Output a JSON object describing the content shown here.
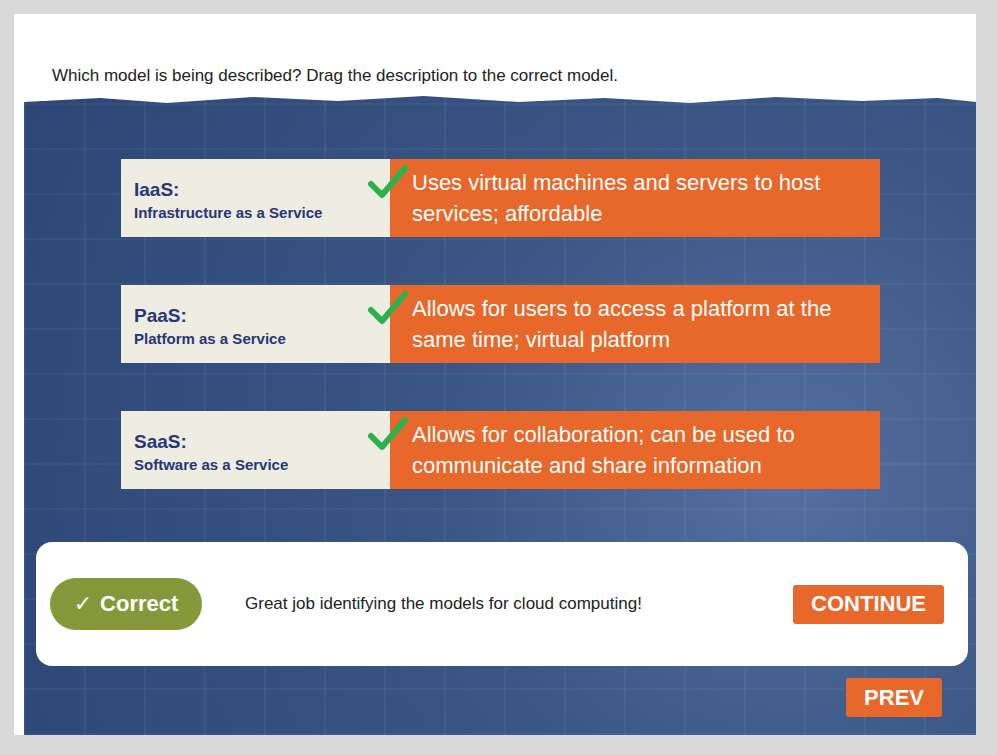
{
  "question": "Which model is being described? Drag the description to the correct model.",
  "matches": [
    {
      "acronym": "IaaS:",
      "name": "Infrastructure as a Service",
      "description": "Uses virtual machines and servers to host services; affordable",
      "correct": true
    },
    {
      "acronym": "PaaS:",
      "name": "Platform as a Service",
      "description": "Allows for users to access a platform at the same time; virtual platform",
      "correct": true
    },
    {
      "acronym": "SaaS:",
      "name": "Software as a Service",
      "description": "Allows for collaboration; can be used to communicate and share information",
      "correct": true
    }
  ],
  "feedback": {
    "badge_icon": "✓",
    "badge": "Correct",
    "message": "Great job identifying the models for cloud computing!",
    "continue": "CONTINUE"
  },
  "prev": "PREV"
}
